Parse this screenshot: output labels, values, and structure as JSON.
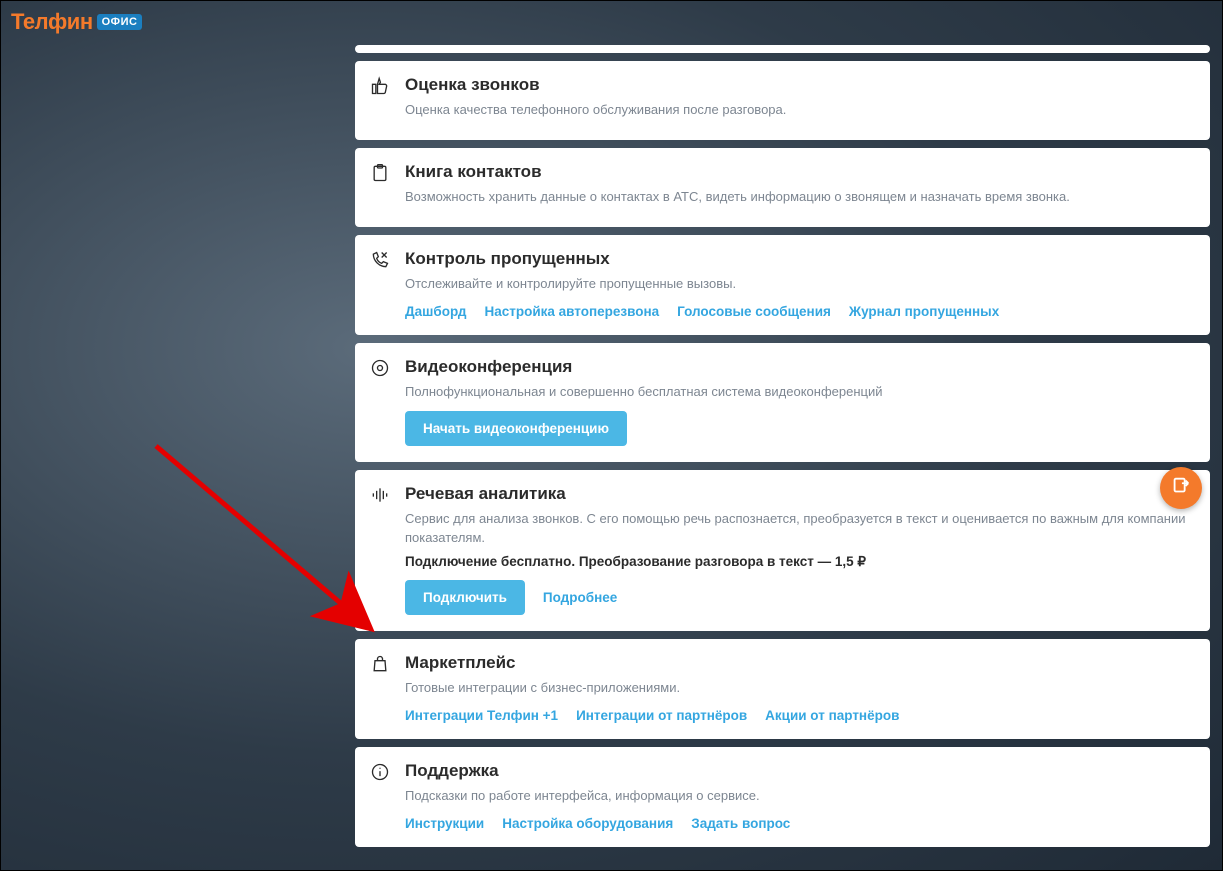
{
  "logo": {
    "text": "Телфин",
    "badge": "ОФИС"
  },
  "cards": [
    {
      "icon": "thumb-up-icon",
      "title": "Оценка звонков",
      "desc": "Оценка качества телефонного обслуживания после разговора."
    },
    {
      "icon": "clipboard-icon",
      "title": "Книга контактов",
      "desc": "Возможность хранить данные о контактах в АТС, видеть информацию о звонящем и назначать время звонка."
    },
    {
      "icon": "missed-call-icon",
      "title": "Контроль пропущенных",
      "desc": "Отслеживайте и контролируйте пропущенные вызовы.",
      "links": [
        "Дашборд",
        "Настройка автоперезвона",
        "Голосовые сообщения",
        "Журнал пропущенных"
      ]
    },
    {
      "icon": "video-icon",
      "title": "Видеоконференция",
      "desc": "Полнофункциональная и совершенно бесплатная система видеоконференций",
      "button": "Начать видеоконференцию"
    },
    {
      "icon": "waveform-icon",
      "title": "Речевая аналитика",
      "desc": "Сервис для анализа звонков. С его помощью речь распознается, преобразуется в текст и оценивается по важным для компании показателям.",
      "price": "Подключение бесплатно. Преобразование разговора в текст — 1,5 ₽",
      "button": "Подключить",
      "links": [
        "Подробнее"
      ]
    },
    {
      "icon": "bag-icon",
      "title": "Маркетплейс",
      "desc": "Готовые интеграции с бизнес-приложениями.",
      "links": [
        "Интеграции Телфин +1",
        "Интеграции от партнёров",
        "Акции от партнёров"
      ]
    },
    {
      "icon": "info-icon",
      "title": "Поддержка",
      "desc": "Подсказки по работе интерфейса, информация о сервисе.",
      "links": [
        "Инструкции",
        "Настройка оборудования",
        "Задать вопрос"
      ]
    }
  ]
}
